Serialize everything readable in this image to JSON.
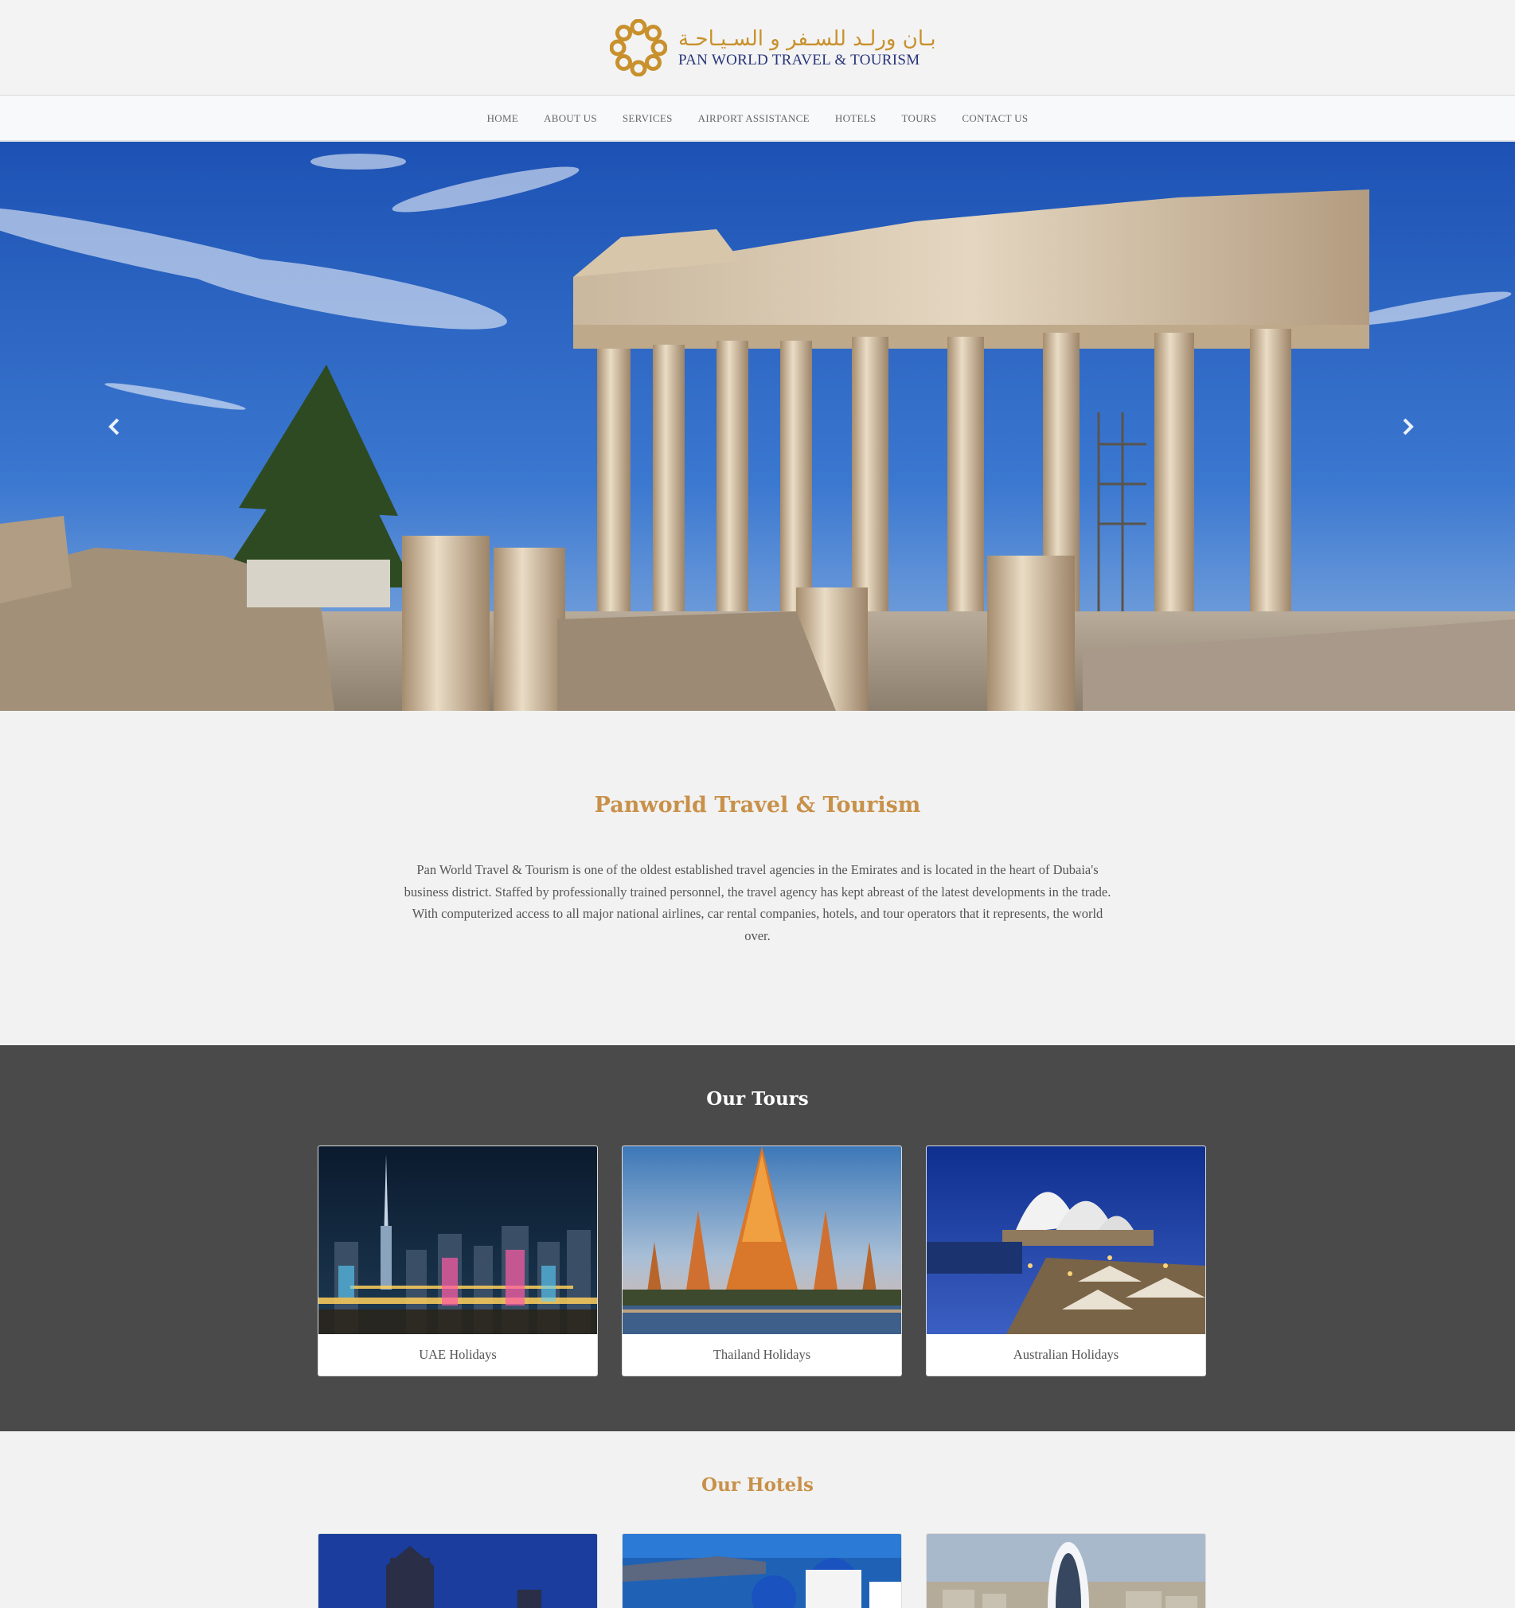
{
  "brand": {
    "arabic_name": "بـان ورلـد للسـفر و السـيـاحـة",
    "english_name": "PAN WORLD TRAVEL & TOURISM",
    "colors": {
      "gold": "#c8912d",
      "navy": "#27357a"
    }
  },
  "nav": {
    "items": [
      {
        "label": "HOME"
      },
      {
        "label": "ABOUT US"
      },
      {
        "label": "SERVICES"
      },
      {
        "label": "AIRPORT ASSISTANCE"
      },
      {
        "label": "HOTELS"
      },
      {
        "label": "TOURS"
      },
      {
        "label": "CONTACT US"
      }
    ]
  },
  "hero": {
    "image": "parthenon-acropolis-photo",
    "prev_icon": "chevron-left-icon",
    "next_icon": "chevron-right-icon"
  },
  "intro": {
    "title": "Panworld Travel & Tourism",
    "text": "Pan World Travel & Tourism is one of the oldest established travel agencies in the Emirates and is located in the heart of Dubaia's business district. Staffed by professionally trained personnel, the travel agency has kept abreast of the latest developments in the trade. With computerized access to all major national airlines, car rental companies, hotels, and tour operators that it represents, the world over."
  },
  "tours": {
    "title": "Our Tours",
    "items": [
      {
        "label": "UAE Holidays",
        "image": "dubai-skyline-night-photo"
      },
      {
        "label": "Thailand Holidays",
        "image": "wat-arun-temple-photo"
      },
      {
        "label": "Australian Holidays",
        "image": "sydney-opera-house-photo"
      }
    ]
  },
  "hotels": {
    "title": "Our Hotels",
    "items": [
      {
        "image": "london-hotel-photo"
      },
      {
        "image": "santorini-hotel-photo"
      },
      {
        "image": "modern-tower-hotel-photo"
      }
    ]
  },
  "colors": {
    "accent": "#c8914a",
    "tours_bg": "#4a4a4a",
    "page_bg": "#f2f2f2"
  }
}
